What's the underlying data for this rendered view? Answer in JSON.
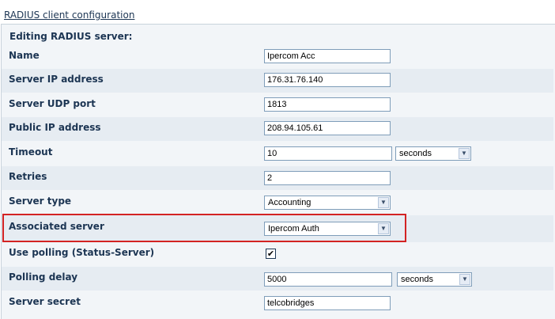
{
  "page": {
    "title": "RADIUS client configuration"
  },
  "section": {
    "legend": "Editing RADIUS server:"
  },
  "fields": {
    "name": {
      "label": "Name",
      "value": "Ipercom Acc"
    },
    "server_ip": {
      "label": "Server IP address",
      "value": "176.31.76.140"
    },
    "server_udp_port": {
      "label": "Server UDP port",
      "value": "1813"
    },
    "public_ip": {
      "label": "Public IP address",
      "value": "208.94.105.61"
    },
    "timeout": {
      "label": "Timeout",
      "value": "10",
      "unit": "seconds"
    },
    "retries": {
      "label": "Retries",
      "value": "2"
    },
    "server_type": {
      "label": "Server type",
      "value": "Accounting"
    },
    "associated_server": {
      "label": "Associated server",
      "value": "Ipercom Auth"
    },
    "use_polling": {
      "label": "Use polling (Status-Server)",
      "checked": true,
      "check_glyph": "✔"
    },
    "polling_delay": {
      "label": "Polling delay",
      "value": "5000",
      "unit": "seconds"
    },
    "server_secret": {
      "label": "Server secret",
      "value": "telcobridges"
    }
  },
  "icons": {
    "dropdown_arrow": "▼"
  },
  "colors": {
    "highlight": "#d32323",
    "label_text": "#1c3553"
  }
}
